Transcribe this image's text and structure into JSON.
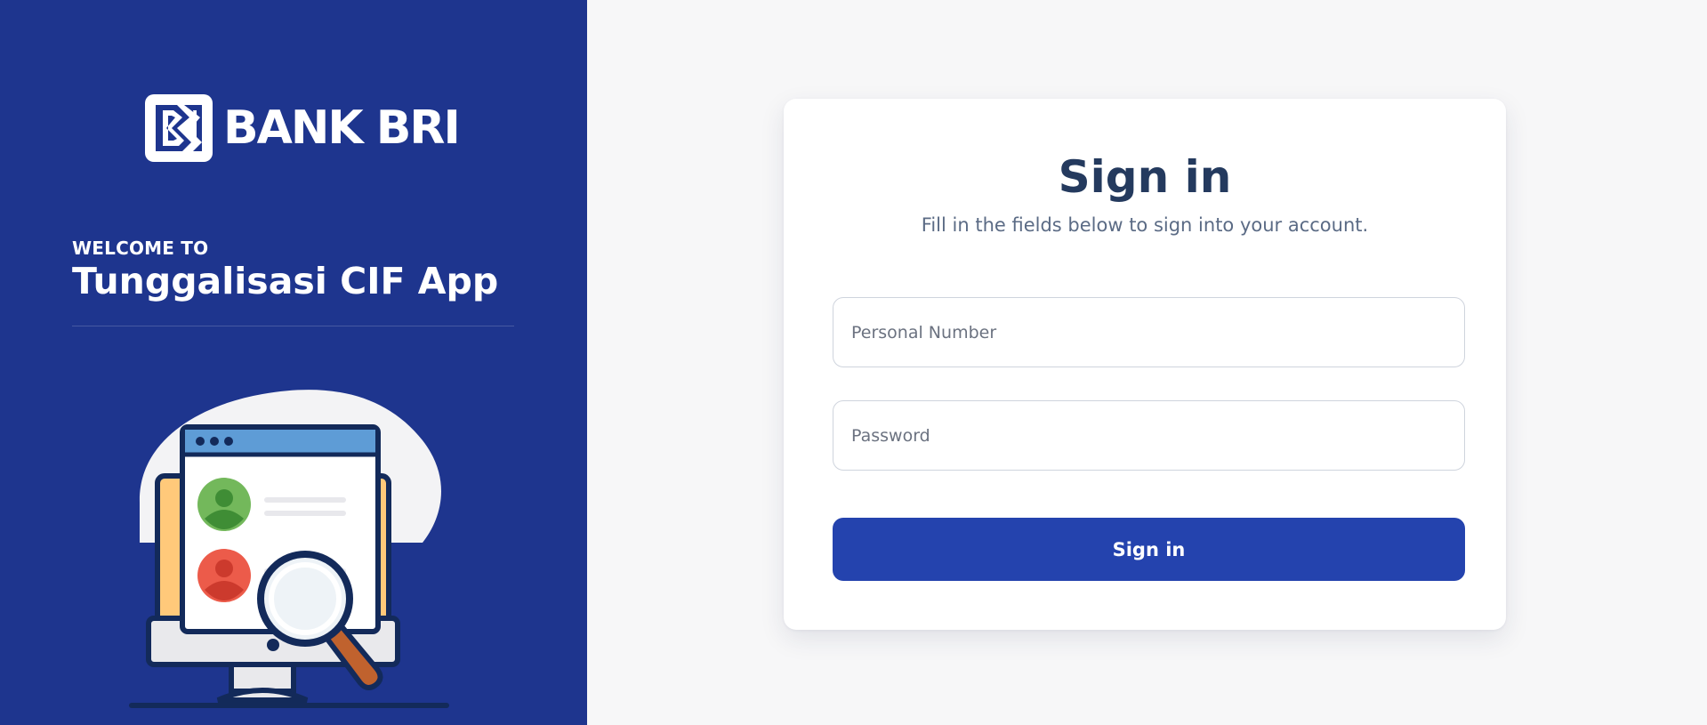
{
  "brand": {
    "name": "BANK BRI",
    "color": "#1e358e"
  },
  "welcome": {
    "small": "WELCOME TO",
    "app_name": "Tunggalisasi CIF App"
  },
  "illustration": {
    "icon": "computer-search-illustration"
  },
  "signin_card": {
    "title": "Sign in",
    "subtitle": "Fill in the fields below to sign into your account.",
    "personal_number": {
      "value": "",
      "placeholder": "Personal Number"
    },
    "password": {
      "value": "",
      "placeholder": "Password"
    },
    "submit_label": "Sign in",
    "button_color": "#2443ae"
  }
}
